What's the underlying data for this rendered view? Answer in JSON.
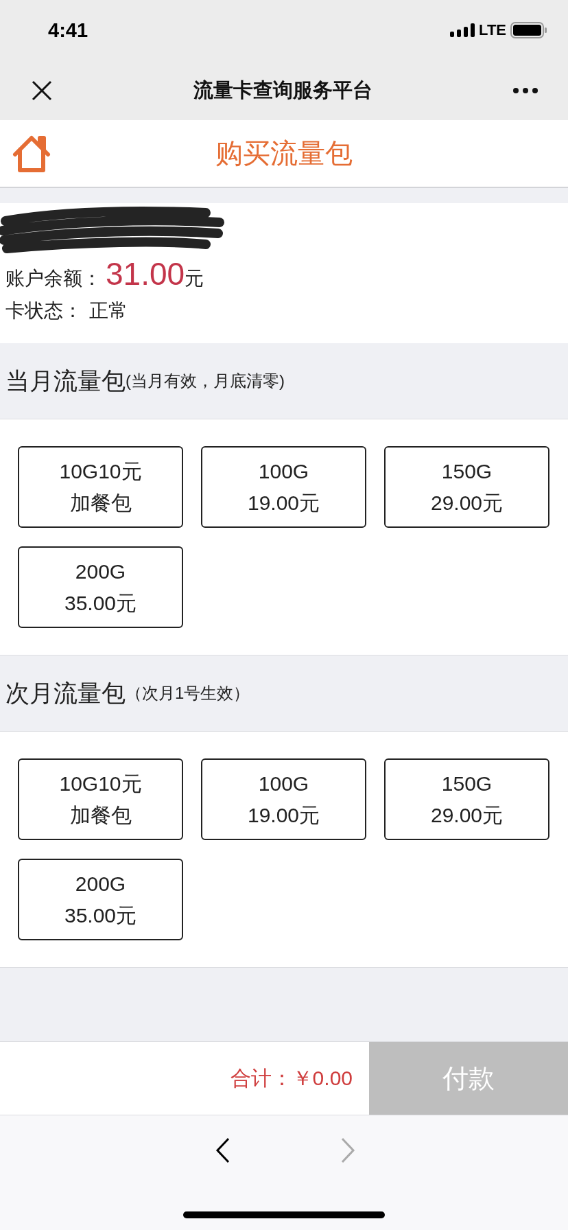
{
  "status_bar": {
    "time": "4:41",
    "network": "LTE"
  },
  "nav_bar": {
    "title": "流量卡查询服务平台"
  },
  "page_header": {
    "title": "购买流量包"
  },
  "account": {
    "balance_label": "账户余额：",
    "balance": "31.00",
    "balance_unit": "元",
    "status_label": "卡状态：",
    "status": "正常"
  },
  "sections": [
    {
      "title": "当月流量包",
      "note": "(当月有效，月底清零)",
      "packages": [
        {
          "line_1": "10G10元",
          "line_2": "加餐包",
          "selected": false
        },
        {
          "line_1": "100G",
          "line_2": "19.00元",
          "selected": false
        },
        {
          "line_1": "150G",
          "line_2": "29.00元",
          "selected": false
        },
        {
          "line_1": "200G",
          "line_2": "35.00元",
          "selected": false
        }
      ]
    },
    {
      "title": "次月流量包",
      "note": "（次月1号生效）",
      "packages": [
        {
          "line_1": "10G10元",
          "line_2": "加餐包",
          "selected": false
        },
        {
          "line_1": "100G",
          "line_2": "19.00元",
          "selected": false
        },
        {
          "line_1": "150G",
          "line_2": "29.00元",
          "selected": false
        },
        {
          "line_1": "200G",
          "line_2": "35.00元",
          "selected": false
        }
      ]
    }
  ],
  "checkout": {
    "total": "合计：￥0.00",
    "pay_button": {
      "label": "付款",
      "disabled": true
    }
  },
  "browser_toolbar": {
    "back": {
      "disabled": false
    },
    "forward": {
      "disabled": true
    }
  }
}
